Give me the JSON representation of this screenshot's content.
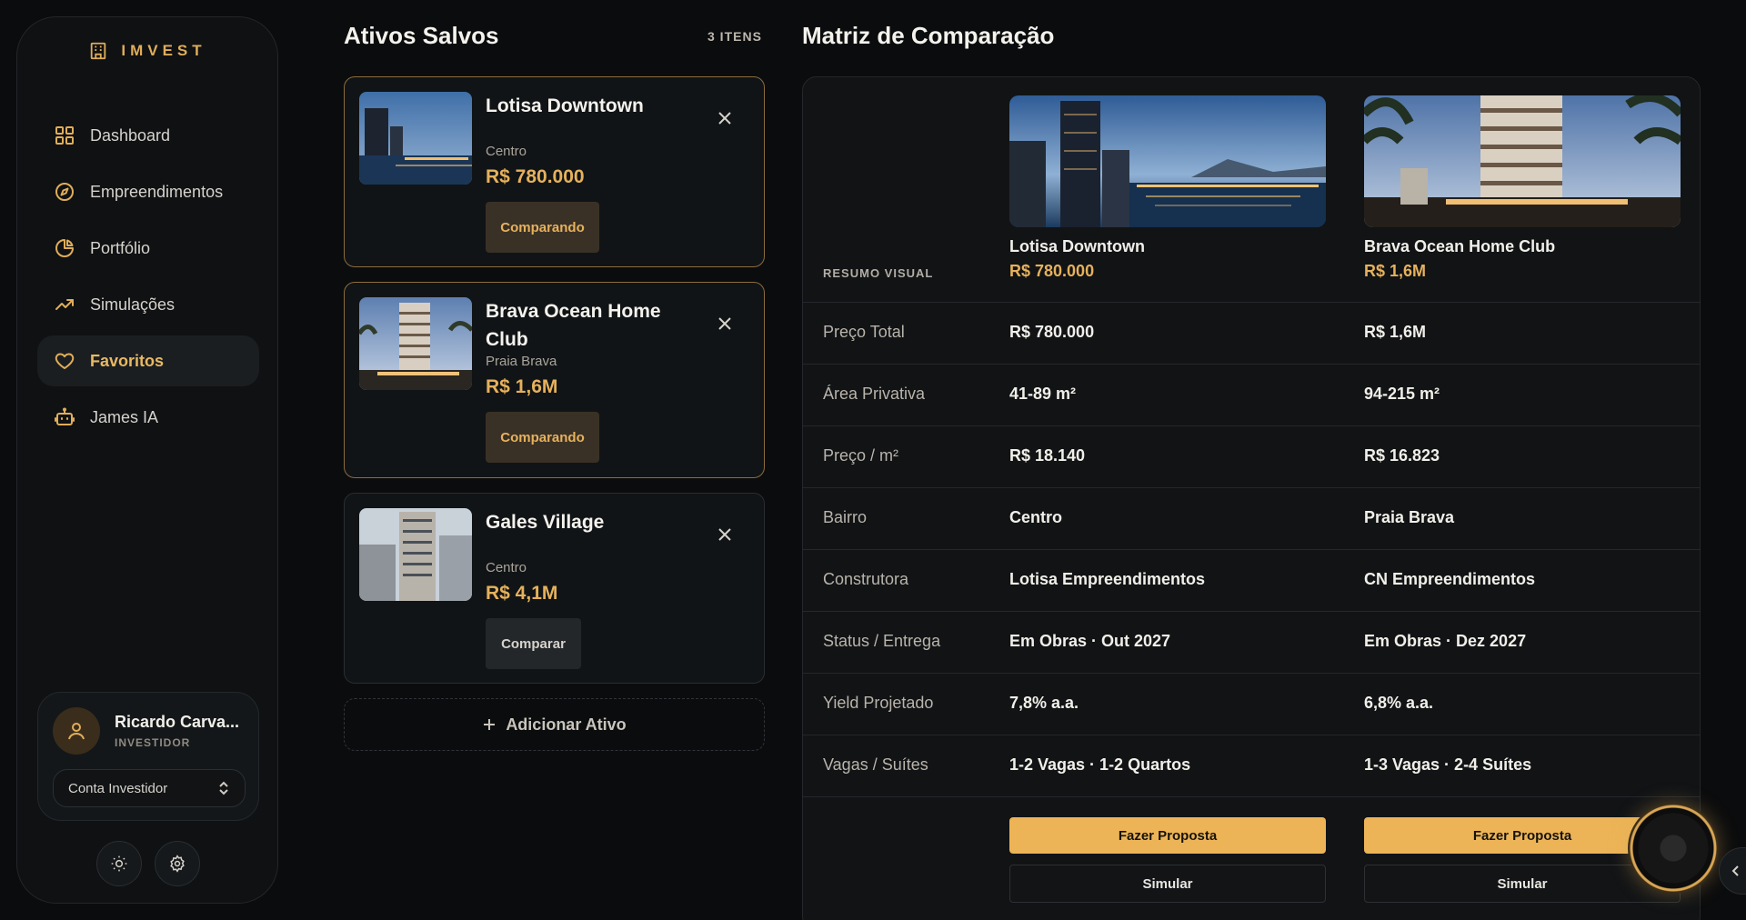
{
  "brand": {
    "name": "IMVEST"
  },
  "nav": {
    "items": [
      {
        "label": "Dashboard",
        "icon": "grid-icon"
      },
      {
        "label": "Empreendimentos",
        "icon": "compass-icon"
      },
      {
        "label": "Portfólio",
        "icon": "pie-chart-icon"
      },
      {
        "label": "Simulações",
        "icon": "trending-up-icon"
      },
      {
        "label": "Favoritos",
        "icon": "heart-icon",
        "active": true
      },
      {
        "label": "James IA",
        "icon": "robot-icon"
      }
    ]
  },
  "user": {
    "name": "Ricardo Carva...",
    "role": "INVESTIDOR",
    "account": "Conta Investidor"
  },
  "saved": {
    "title": "Ativos Salvos",
    "count": "3 ITENS",
    "items": [
      {
        "name": "Lotisa Downtown",
        "location": "Centro",
        "price": "R$ 780.000",
        "button": "Comparando",
        "state": "comparing"
      },
      {
        "name": "Brava Ocean Home Club",
        "location": "Praia Brava",
        "price": "R$ 1,6M",
        "button": "Comparando",
        "state": "comparing"
      },
      {
        "name": "Gales Village",
        "location": "Centro",
        "price": "R$ 4,1M",
        "button": "Comparar",
        "state": "idle"
      }
    ],
    "add_label": "Adicionar Ativo"
  },
  "matrix": {
    "title": "Matriz de Comparação",
    "visual_label": "RESUMO VISUAL",
    "properties": [
      {
        "name": "Lotisa Downtown",
        "price": "R$ 780.000"
      },
      {
        "name": "Brava Ocean Home Club",
        "price": "R$ 1,6M"
      }
    ],
    "rows": [
      {
        "label": "Preço Total",
        "values": [
          "R$ 780.000",
          "R$ 1,6M"
        ]
      },
      {
        "label": "Área Privativa",
        "values": [
          "41-89 m²",
          "94-215 m²"
        ]
      },
      {
        "label": "Preço / m²",
        "values": [
          "R$ 18.140",
          "R$ 16.823"
        ]
      },
      {
        "label": "Bairro",
        "values": [
          "Centro",
          "Praia Brava"
        ]
      },
      {
        "label": "Construtora",
        "values": [
          "Lotisa Empreendimentos",
          "CN Empreendimentos"
        ]
      },
      {
        "label": "Status / Entrega",
        "values": [
          "Em Obras · Out 2027",
          "Em Obras · Dez 2027"
        ]
      },
      {
        "label": "Yield Projetado",
        "values": [
          "7,8% a.a.",
          "6,8% a.a."
        ]
      },
      {
        "label": "Vagas / Suítes",
        "values": [
          "1-2 Vagas · 1-2 Quartos",
          "1-3 Vagas · 2-4 Suítes"
        ]
      }
    ],
    "proposal_label": "Fazer Proposta",
    "simulate_label": "Simular"
  },
  "colors": {
    "accent": "#e6b15c",
    "background": "#0b0c0d",
    "panel": "#111315"
  }
}
